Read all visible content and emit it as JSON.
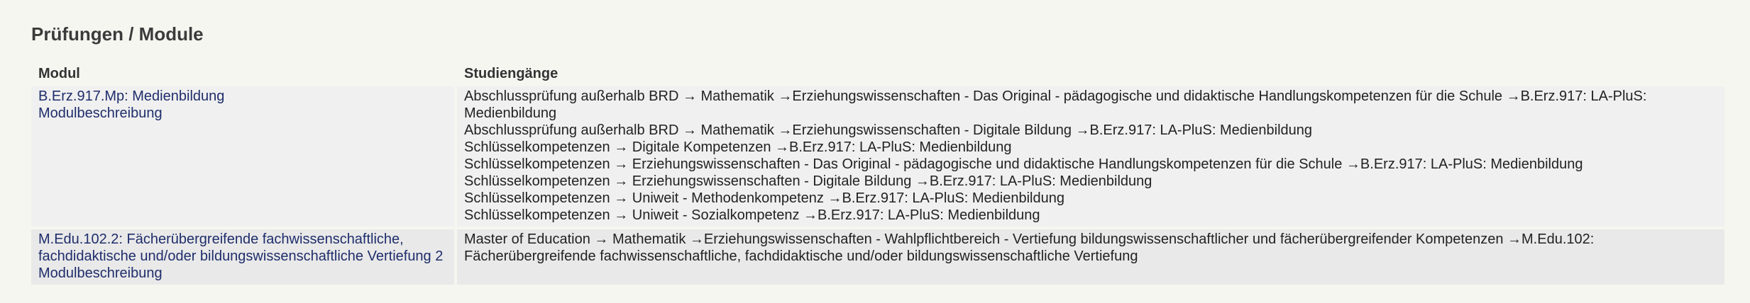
{
  "section": {
    "title": "Prüfungen / Module"
  },
  "table": {
    "headers": {
      "module": "Modul",
      "courses": "Studiengänge"
    },
    "rows": [
      {
        "module_name": "B.Erz.917.Mp: Medienbildung",
        "description_link": "Modulbeschreibung",
        "paths": [
          "Abschlussprüfung außerhalb BRD → Mathematik →Erziehungswissenschaften - Das Original - pädagogische und didaktische Handlungskompetenzen für die Schule →B.Erz.917: LA-PluS: Medienbildung",
          "Abschlussprüfung außerhalb BRD → Mathematik →Erziehungswissenschaften - Digitale Bildung →B.Erz.917: LA-PluS: Medienbildung",
          "Schlüsselkompetenzen → Digitale Kompetenzen →B.Erz.917: LA-PluS: Medienbildung",
          "Schlüsselkompetenzen → Erziehungswissenschaften - Das Original - pädagogische und didaktische Handlungskompetenzen für die Schule →B.Erz.917: LA-PluS: Medienbildung",
          "Schlüsselkompetenzen → Erziehungswissenschaften - Digitale Bildung →B.Erz.917: LA-PluS: Medienbildung",
          "Schlüsselkompetenzen → Uniweit - Methodenkompetenz →B.Erz.917: LA-PluS: Medienbildung",
          "Schlüsselkompetenzen → Uniweit - Sozialkompetenz →B.Erz.917: LA-PluS: Medienbildung"
        ]
      },
      {
        "module_name": "M.Edu.102.2: Fächerübergreifende fachwissenschaftliche, fachdidaktische und/oder bildungswissenschaftliche Vertiefung 2",
        "description_link": "Modulbeschreibung",
        "paths": [
          "Master of Education → Mathematik →Erziehungswissenschaften - Wahlpflichtbereich - Vertiefung bildungswissenschaftlicher und fächerübergreifender Kompetenzen →M.Edu.102: Fächerübergreifende fachwissenschaftliche, fachdidaktische und/oder bildungswissenschaftliche Vertiefung"
        ]
      }
    ]
  }
}
